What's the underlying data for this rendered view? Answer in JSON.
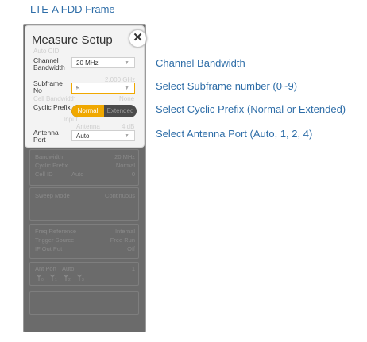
{
  "page": {
    "title": "LTE-A FDD Frame"
  },
  "panel": {
    "title": "Measure Setup",
    "close_icon": "close-icon",
    "ghost": {
      "g1": "Auto CID",
      "g2": "2.000 GHz",
      "g3": "Cell Bandwidth",
      "g4": "None",
      "g5": "Input",
      "g6": "Antenna",
      "g7": "4 dB"
    },
    "fields": {
      "bandwidth": {
        "label": "Channel Bandwidth",
        "value": "20 MHz"
      },
      "subframe": {
        "label": "Subframe No",
        "value": "5"
      },
      "cyclic_prefix": {
        "label": "Cyclic Prefix",
        "options": [
          "Normal",
          "Extended"
        ],
        "selected": "Normal"
      },
      "antenna_port": {
        "label": "Antenna Port",
        "value": "Auto"
      }
    },
    "summary": {
      "bandwidth_label": "Bandwidth",
      "bandwidth_value": "20 MHz",
      "cp_label": "Cyclic Prefix",
      "cp_value": "Normal",
      "cellid_label": "Cell ID",
      "cellid_mid": "Auto",
      "cellid_value": "0"
    },
    "sweep": {
      "label": "Sweep Mode",
      "value": "Continuous"
    },
    "reference": {
      "freq_label": "Freq Reference",
      "freq_value": "Internal",
      "trigger_label": "Trigger Source",
      "trigger_value": "Free Run",
      "if_label": "IF Out Put",
      "if_value": "Off"
    },
    "antenna_box": {
      "label": "Ant Port",
      "mid": "Auto",
      "value": "1",
      "icons": [
        "ant0",
        "ant1",
        "ant2",
        "ant3"
      ]
    }
  },
  "annotations": [
    "Channel Bandwidth",
    "Select Subframe number (0~9)",
    "Select Cyclic Prefix (Normal or Extended)",
    "Select Antenna Port (Auto, 1, 2, 4)"
  ]
}
